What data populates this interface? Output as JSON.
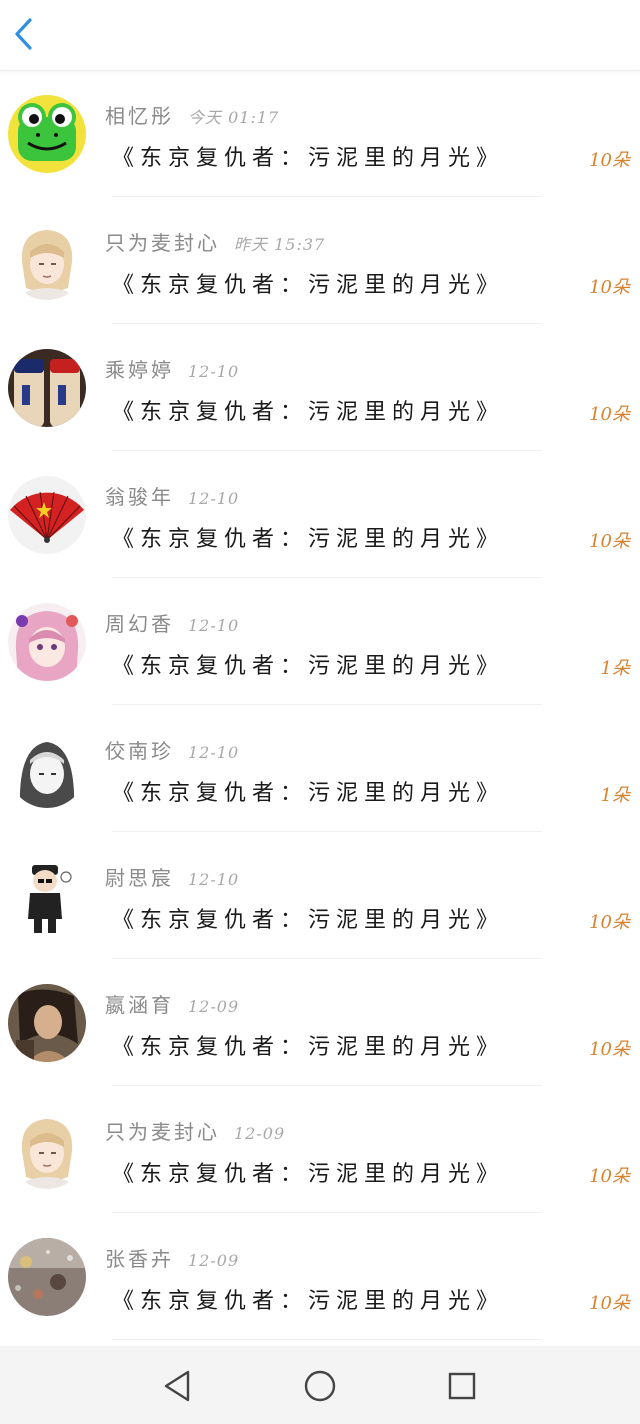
{
  "header": {
    "back_icon": "chevron-left-icon",
    "accent": "#2f8fe0"
  },
  "accent_count_color": "#d8822f",
  "rows": [
    {
      "name": "相忆彤",
      "time": "今天 01:17",
      "book": "《东京复仇者：污泥里的月光》",
      "count": "10朵",
      "avatar": "frog"
    },
    {
      "name": "只为麦封心",
      "time": "昨天 15:37",
      "book": "《东京复仇者：污泥里的月光》",
      "count": "10朵",
      "avatar": "anime-blonde"
    },
    {
      "name": "乘婷婷",
      "time": "12-10",
      "book": "《东京复仇者：污泥里的月光》",
      "count": "10朵",
      "avatar": "bottles"
    },
    {
      "name": "翁骏年",
      "time": "12-10",
      "book": "《东京复仇者：污泥里的月光》",
      "count": "10朵",
      "avatar": "red-fan"
    },
    {
      "name": "周幻香",
      "time": "12-10",
      "book": "《东京复仇者：污泥里的月光》",
      "count": "1朵",
      "avatar": "anime-pink"
    },
    {
      "name": "佼南珍",
      "time": "12-10",
      "book": "《东京复仇者：污泥里的月光》",
      "count": "1朵",
      "avatar": "sketch-hood"
    },
    {
      "name": "尉思宸",
      "time": "12-10",
      "book": "《东京复仇者：污泥里的月光》",
      "count": "10朵",
      "avatar": "cartoon-boy"
    },
    {
      "name": "嬴涵育",
      "time": "12-09",
      "book": "《东京复仇者：污泥里的月光》",
      "count": "10朵",
      "avatar": "photo-woman"
    },
    {
      "name": "只为麦封心",
      "time": "12-09",
      "book": "《东京复仇者：污泥里的月光》",
      "count": "10朵",
      "avatar": "anime-blonde"
    },
    {
      "name": "张香卉",
      "time": "12-09",
      "book": "《东京复仇者：污泥里的月光》",
      "count": "10朵",
      "avatar": "rainy-window"
    }
  ],
  "navbar": {
    "back": "nav-back-triangle-icon",
    "home": "nav-home-circle-icon",
    "recents": "nav-recents-square-icon"
  }
}
